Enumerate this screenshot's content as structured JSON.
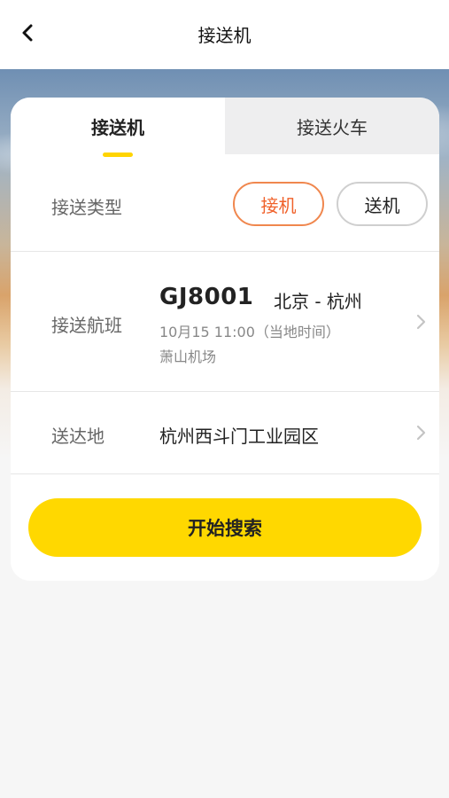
{
  "header": {
    "title": "接送机",
    "back_icon": "chevron-left-icon"
  },
  "tabs": [
    {
      "label": "接送机",
      "active": true
    },
    {
      "label": "接送火车",
      "active": false
    }
  ],
  "transfer_type": {
    "label": "接送类型",
    "options": [
      {
        "label": "接机",
        "selected": true
      },
      {
        "label": "送机",
        "selected": false
      }
    ]
  },
  "flight": {
    "label": "接送航班",
    "number": "GJ8001",
    "route": "北京 - 杭州",
    "time": "10月15 11:00（当地时间）",
    "airport": "萧山机场"
  },
  "destination": {
    "label": "送达地",
    "value": "杭州西斗门工业园区"
  },
  "search_button": {
    "label": "开始搜索"
  },
  "colors": {
    "accent_yellow": "#ffd800",
    "selected_orange": "#f0612a"
  }
}
